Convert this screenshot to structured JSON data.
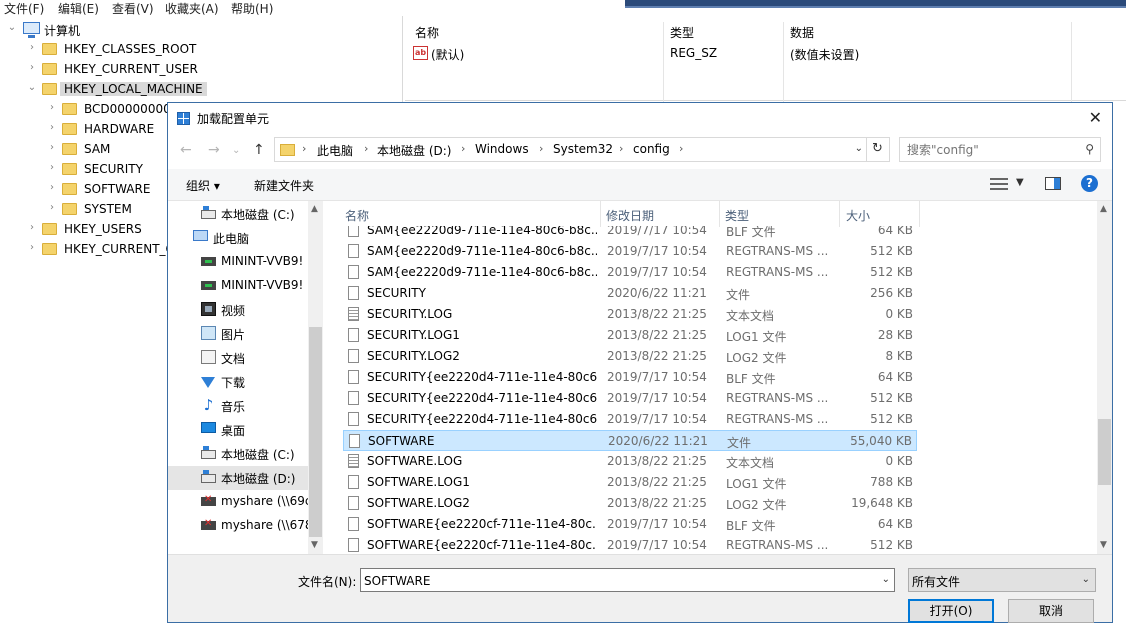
{
  "regedit": {
    "menu": [
      "文件(F)",
      "编辑(E)",
      "查看(V)",
      "收藏夹(A)",
      "帮助(H)"
    ],
    "tree": {
      "root": "计算机",
      "items": [
        {
          "label": "HKEY_CLASSES_ROOT",
          "level": 1,
          "expanded": false
        },
        {
          "label": "HKEY_CURRENT_USER",
          "level": 1,
          "expanded": false
        },
        {
          "label": "HKEY_LOCAL_MACHINE",
          "level": 1,
          "expanded": true,
          "selected": true
        },
        {
          "label": "BCD00000000",
          "level": 2,
          "expanded": false
        },
        {
          "label": "HARDWARE",
          "level": 2,
          "expanded": false
        },
        {
          "label": "SAM",
          "level": 2,
          "expanded": false
        },
        {
          "label": "SECURITY",
          "level": 2,
          "expanded": false
        },
        {
          "label": "SOFTWARE",
          "level": 2,
          "expanded": false
        },
        {
          "label": "SYSTEM",
          "level": 2,
          "expanded": false
        },
        {
          "label": "HKEY_USERS",
          "level": 1,
          "expanded": false
        },
        {
          "label": "HKEY_CURRENT_C",
          "level": 1,
          "expanded": false
        }
      ]
    },
    "list": {
      "headers": {
        "name": "名称",
        "type": "类型",
        "data": "数据"
      },
      "row": {
        "name": "(默认)",
        "type": "REG_SZ",
        "data": "(数值未设置)"
      }
    }
  },
  "dialog": {
    "title": "加载配置单元",
    "close_label": "✕",
    "breadcrumb": [
      "此电脑",
      "本地磁盘 (D:)",
      "Windows",
      "System32",
      "config"
    ],
    "search_placeholder": "搜索\"config\"",
    "toolbar": {
      "organize": "组织 ▾",
      "new_folder": "新建文件夹"
    },
    "nav": [
      {
        "label": "本地磁盘 (C:)",
        "icon": "drive-icon",
        "indent": 1
      },
      {
        "label": "此电脑",
        "icon": "pc-icon",
        "indent": 0
      },
      {
        "label": "MININT-VVB9!",
        "icon": "network-drive-icon",
        "indent": 1
      },
      {
        "label": "MININT-VVB9!",
        "icon": "network-drive-icon",
        "indent": 1
      },
      {
        "label": "视频",
        "icon": "video-icon",
        "indent": 1
      },
      {
        "label": "图片",
        "icon": "picture-icon",
        "indent": 1
      },
      {
        "label": "文档",
        "icon": "document-icon",
        "indent": 1
      },
      {
        "label": "下载",
        "icon": "download-icon",
        "indent": 1
      },
      {
        "label": "音乐",
        "icon": "music-icon",
        "indent": 1
      },
      {
        "label": "桌面",
        "icon": "desktop-icon",
        "indent": 1
      },
      {
        "label": "本地磁盘 (C:)",
        "icon": "drive-icon",
        "indent": 1
      },
      {
        "label": "本地磁盘 (D:)",
        "icon": "drive-icon",
        "indent": 1,
        "active": true
      },
      {
        "label": "myshare (\\\\69c",
        "icon": "disconnected-drive-icon",
        "indent": 1
      },
      {
        "label": "myshare (\\\\678",
        "icon": "disconnected-drive-icon",
        "indent": 1
      }
    ],
    "columns": {
      "name": "名称",
      "date": "修改日期",
      "type": "类型",
      "size": "大小"
    },
    "files": [
      {
        "name": "SAM{ee2220d9-711e-11e4-80c6-b8c...",
        "date": "2019/7/17 10:54",
        "type": "BLF 文件",
        "size": "64 KB",
        "icon": "file"
      },
      {
        "name": "SAM{ee2220d9-711e-11e4-80c6-b8c...",
        "date": "2019/7/17 10:54",
        "type": "REGTRANS-MS ...",
        "size": "512 KB",
        "icon": "file"
      },
      {
        "name": "SAM{ee2220d9-711e-11e4-80c6-b8c...",
        "date": "2019/7/17 10:54",
        "type": "REGTRANS-MS ...",
        "size": "512 KB",
        "icon": "file"
      },
      {
        "name": "SECURITY",
        "date": "2020/6/22 11:21",
        "type": "文件",
        "size": "256 KB",
        "icon": "file"
      },
      {
        "name": "SECURITY.LOG",
        "date": "2013/8/22 21:25",
        "type": "文本文档",
        "size": "0 KB",
        "icon": "log"
      },
      {
        "name": "SECURITY.LOG1",
        "date": "2013/8/22 21:25",
        "type": "LOG1 文件",
        "size": "28 KB",
        "icon": "file"
      },
      {
        "name": "SECURITY.LOG2",
        "date": "2013/8/22 21:25",
        "type": "LOG2 文件",
        "size": "8 KB",
        "icon": "file"
      },
      {
        "name": "SECURITY{ee2220d4-711e-11e4-80c6...",
        "date": "2019/7/17 10:54",
        "type": "BLF 文件",
        "size": "64 KB",
        "icon": "file"
      },
      {
        "name": "SECURITY{ee2220d4-711e-11e4-80c6...",
        "date": "2019/7/17 10:54",
        "type": "REGTRANS-MS ...",
        "size": "512 KB",
        "icon": "file"
      },
      {
        "name": "SECURITY{ee2220d4-711e-11e4-80c6...",
        "date": "2019/7/17 10:54",
        "type": "REGTRANS-MS ...",
        "size": "512 KB",
        "icon": "file"
      },
      {
        "name": "SOFTWARE",
        "date": "2020/6/22 11:21",
        "type": "文件",
        "size": "55,040 KB",
        "icon": "file",
        "selected": true
      },
      {
        "name": "SOFTWARE.LOG",
        "date": "2013/8/22 21:25",
        "type": "文本文档",
        "size": "0 KB",
        "icon": "log"
      },
      {
        "name": "SOFTWARE.LOG1",
        "date": "2013/8/22 21:25",
        "type": "LOG1 文件",
        "size": "788 KB",
        "icon": "file"
      },
      {
        "name": "SOFTWARE.LOG2",
        "date": "2013/8/22 21:25",
        "type": "LOG2 文件",
        "size": "19,648 KB",
        "icon": "file"
      },
      {
        "name": "SOFTWARE{ee2220cf-711e-11e4-80c...",
        "date": "2019/7/17 10:54",
        "type": "BLF 文件",
        "size": "64 KB",
        "icon": "file"
      },
      {
        "name": "SOFTWARE{ee2220cf-711e-11e4-80c...",
        "date": "2019/7/17 10:54",
        "type": "REGTRANS-MS ...",
        "size": "512 KB",
        "icon": "file"
      }
    ],
    "filename_label": "文件名(N):",
    "filename_value": "SOFTWARE",
    "filetype_value": "所有文件",
    "open_label": "打开(O)",
    "cancel_label": "取消"
  }
}
